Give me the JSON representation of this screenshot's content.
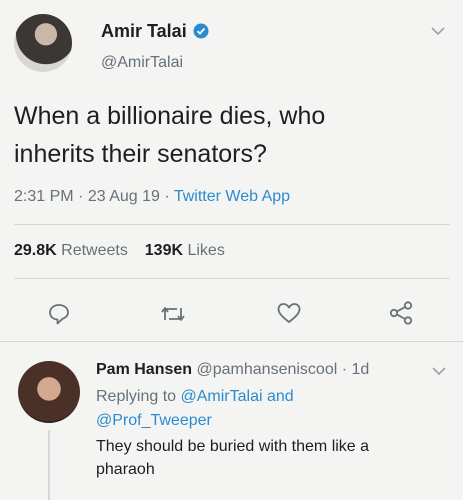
{
  "tweet": {
    "display_name": "Amir Talai",
    "handle": "@AmirTalai",
    "text_line1": "When a billionaire dies, who",
    "text_line2": "inherits their senators?",
    "time": "2:31 PM",
    "dot1": "·",
    "date": "23 Aug 19",
    "dot2": "·",
    "client": "Twitter Web App",
    "retweets_count": "29.8K",
    "retweets_label": "Retweets",
    "likes_count": "139K",
    "likes_label": "Likes"
  },
  "reply": {
    "display_name": "Pam Hansen",
    "handle_time": "@pamhanseniscool · 1d",
    "replying_to_label": "Replying to",
    "replying_to_user1": "@AmirTalai",
    "replying_and": "and",
    "replying_to_user2": "@Prof_Tweeper",
    "text_line1": "They should be buried with them like a",
    "text_line2": "pharaoh"
  },
  "icons": {
    "verified": "verified-badge-icon",
    "chevron": "chevron-down-icon",
    "reply": "reply-icon",
    "retweet": "retweet-icon",
    "like": "heart-icon",
    "share": "share-icon"
  },
  "colors": {
    "accent": "#2a8bd0",
    "text": "#1c1f22",
    "muted": "#667179",
    "background": "#f4f5f3"
  }
}
